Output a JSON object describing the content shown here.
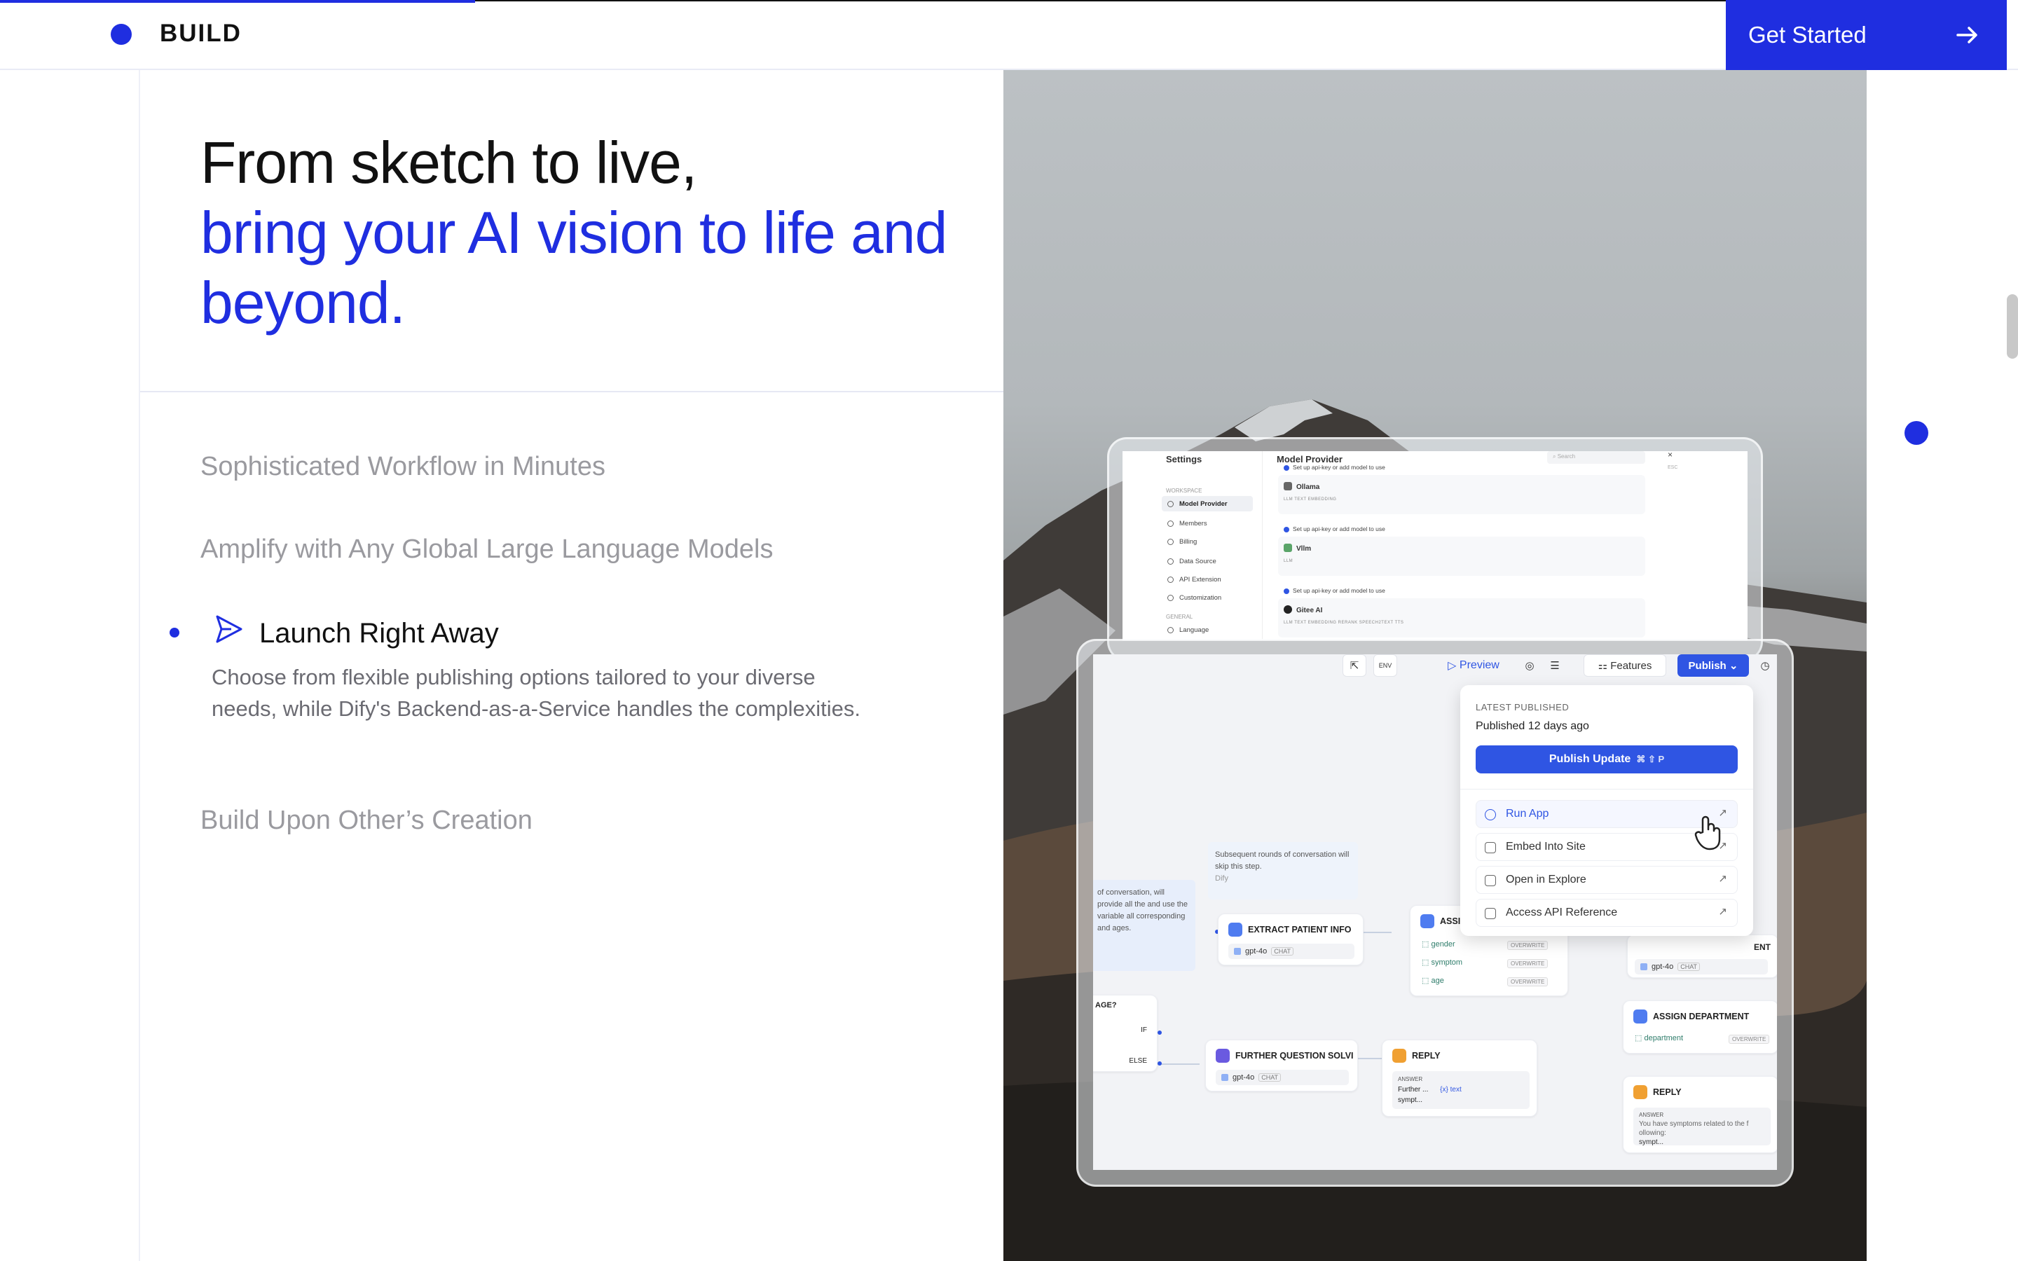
{
  "nav": {
    "title": "BUILD",
    "cta_label": "Get Started"
  },
  "hero": {
    "line1": "From sketch to live,",
    "line2": "bring your AI vision to life and",
    "line3": "beyond."
  },
  "features": {
    "item1": "Sophisticated Workflow in Minutes",
    "item2": "Amplify with Any Global Large Language Models",
    "active_title": "Launch Right Away",
    "active_desc": "Choose from flexible publishing options tailored to your diverse needs, while Dify's Backend-as-a-Service handles the complexities.",
    "item4": "Build Upon Other’s Creation"
  },
  "settings_window": {
    "title": "Settings",
    "section_workspace": "WORKSPACE",
    "section_general": "GENERAL",
    "items": [
      "Model Provider",
      "Members",
      "Billing",
      "Data Source",
      "API Extension",
      "Customization"
    ],
    "general_items": [
      "Language"
    ],
    "main_title": "Model Provider",
    "search_placeholder": "Search",
    "close": "×",
    "esc": "ESC",
    "note": "Set up api-key or add model to use",
    "providers": [
      {
        "name": "Ollama",
        "tags": "LLM   TEXT EMBEDDING"
      },
      {
        "name": "Vllm",
        "tags": "LLM"
      },
      {
        "name": "Gitee AI",
        "tags": "LLM   TEXT EMBEDDING   RERANK   SPEECH2TEXT   TTS"
      }
    ]
  },
  "workflow_window": {
    "toolbar": {
      "env": "ENV",
      "preview": "Preview",
      "features": "Features",
      "publish": "Publish"
    },
    "popover": {
      "label": "LATEST PUBLISHED",
      "published": "Published 12 days ago",
      "publish_update": "Publish Update",
      "shortcut": "⌘ ⇧ P",
      "items": [
        "Run App",
        "Embed Into Site",
        "Open in Explore",
        "Access API Reference"
      ],
      "ext": "↗"
    },
    "nodes": {
      "note_a": "Subsequent rounds of conversation will skip this step.",
      "note_a_author": "Dify",
      "note_b": "of conversation, will provide all the and use the variable all corresponding and ages.",
      "extract": "EXTRACT PATIENT INFO",
      "assign": "ASSI",
      "further": "FURTHER QUESTION SOLVI",
      "reply1": "REPLY",
      "assign_dept": "ASSIGN DEPARTMENT",
      "reply2": "REPLY",
      "ent": "ENT",
      "model": "gpt-4o",
      "chat": "CHAT",
      "overwrite": "OVERWRITE",
      "vars": [
        "gender",
        "symptom",
        "age"
      ],
      "department": "department",
      "if": "IF",
      "else": "ELSE",
      "age_q": "AGE?",
      "answer": "ANSWER",
      "reply1_line1": "Further ...",
      "reply1_var": "{x} text",
      "reply1_line2": "sympt...",
      "reply2_text": "You have symptoms related to the f ollowing:",
      "reply2_var": "sympt..."
    }
  },
  "colors": {
    "accent": "#1f2ee0",
    "muted_text": "#9a9a9f",
    "body_text": "#6b6b72",
    "app_blue": "#2f55e3"
  }
}
